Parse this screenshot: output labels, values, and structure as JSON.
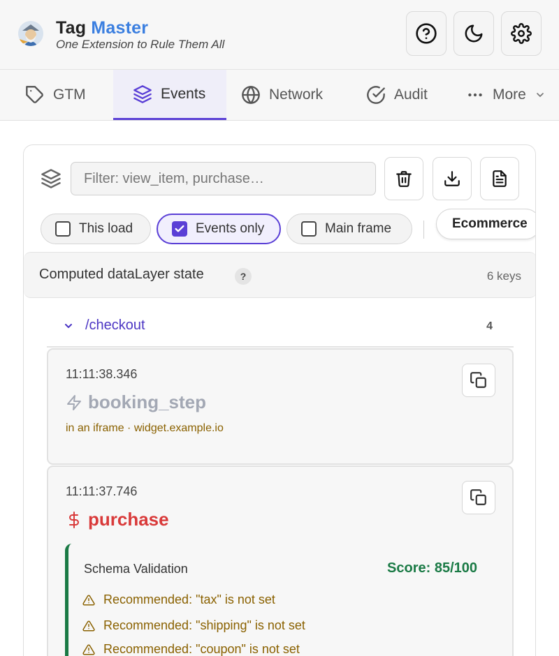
{
  "header": {
    "title_main": "Tag",
    "title_accent": "Master",
    "subtitle": "One Extension to Rule Them All",
    "buttons": [
      {
        "icon": "help-circle-icon"
      },
      {
        "icon": "moon-icon"
      },
      {
        "icon": "gear-icon"
      }
    ]
  },
  "tabs": [
    {
      "label": "GTM",
      "icon": "tag-icon"
    },
    {
      "label": "Events",
      "icon": "layers-icon",
      "active": true
    },
    {
      "label": "Network",
      "icon": "globe-icon"
    },
    {
      "label": "Audit",
      "icon": "check-circle-icon"
    },
    {
      "label": "More",
      "icon": "dots-icon"
    }
  ],
  "toolbar": {
    "filter_placeholder": "Filter: view_item, purchase…",
    "filter_value": ""
  },
  "chips": [
    {
      "label": "This load",
      "checked": false
    },
    {
      "label": "Events only",
      "checked": true
    },
    {
      "label": "Main frame",
      "checked": false
    },
    {
      "label": "Ecommerce",
      "checked": false
    }
  ],
  "state": {
    "title": "Computed dataLayer state",
    "help": "?",
    "keys": "6 keys"
  },
  "group": {
    "path": "/checkout",
    "count": "4"
  },
  "events": [
    {
      "time": "11:11:38.346",
      "name": "booking_step",
      "frame": "in an iframe · widget.example.io",
      "color": "#a3a8b4"
    },
    {
      "time": "11:11:37.746",
      "name": "purchase",
      "color": "#d93a3a",
      "schema": {
        "title": "Schema Validation",
        "score": "Score: 85/100",
        "warnings": [
          "Recommended: \"tax\" is not set",
          "Recommended: \"shipping\" is not set",
          "Recommended: \"coupon\" is not set"
        ]
      }
    }
  ],
  "colors": {
    "accent": "#5a3fd6",
    "brand_blue": "#3b7fe0",
    "success": "#1a7a45",
    "warning": "#8a6100",
    "error": "#d93a3a"
  }
}
